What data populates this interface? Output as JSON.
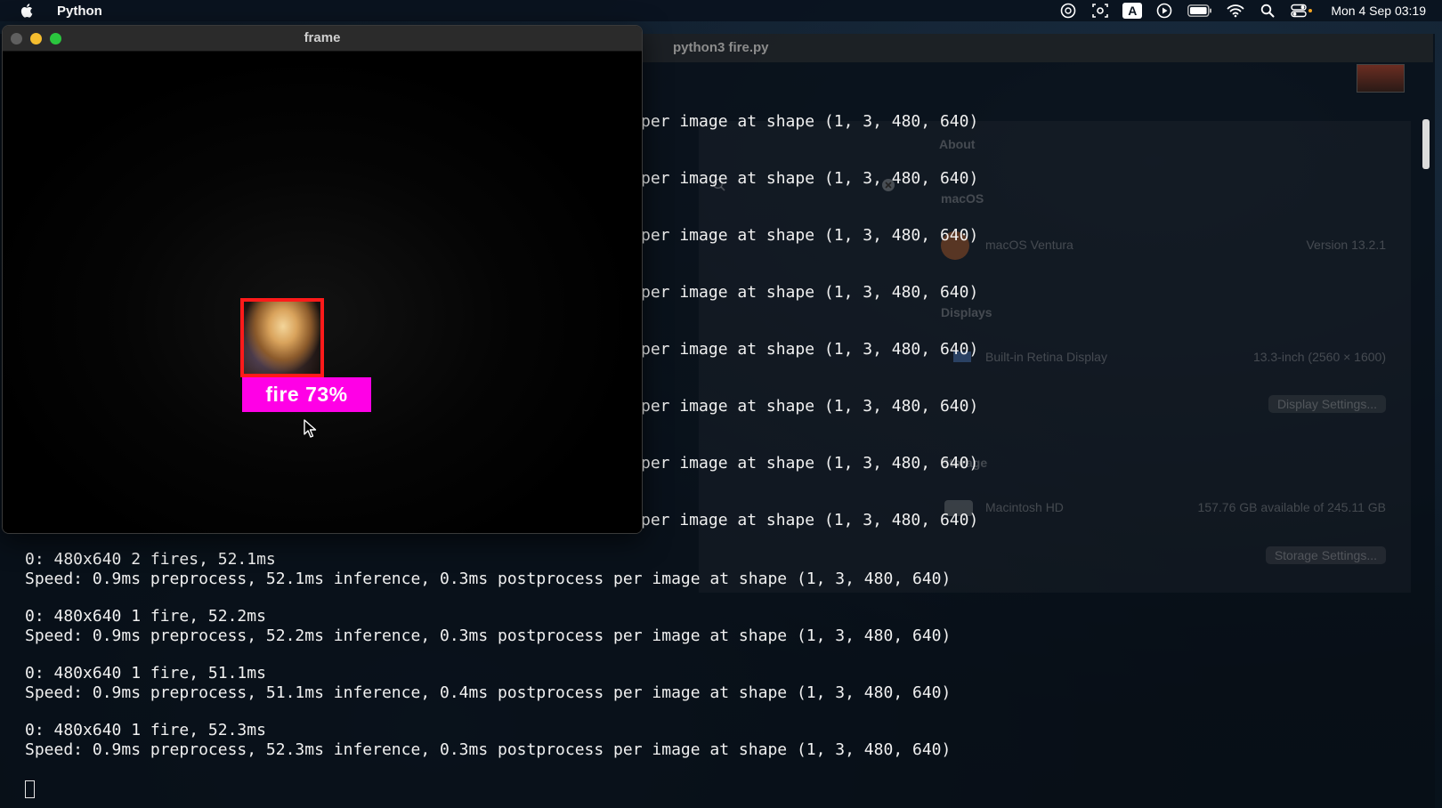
{
  "menubar": {
    "app_name": "Python",
    "clock": "Mon 4 Sep  03:19",
    "icons": [
      "apple-icon",
      "creative-cloud-icon",
      "screenshot-icon",
      "input-source-icon",
      "play-icon",
      "battery-icon",
      "wifi-icon",
      "spotlight-icon",
      "control-center-icon"
    ],
    "input_source": "A"
  },
  "terminal": {
    "title": "python3 fire.py",
    "partial_line": "per image at shape (1, 3, 480, 640)",
    "lines": [
      "0: 480x640 2 fires, 52.1ms",
      "Speed: 0.9ms preprocess, 52.1ms inference, 0.3ms postprocess per image at shape (1, 3, 480, 640)",
      "",
      "0: 480x640 1 fire, 52.2ms",
      "Speed: 0.9ms preprocess, 52.2ms inference, 0.3ms postprocess per image at shape (1, 3, 480, 640)",
      "",
      "0: 480x640 1 fire, 51.1ms",
      "Speed: 0.9ms preprocess, 51.1ms inference, 0.4ms postprocess per image at shape (1, 3, 480, 640)",
      "",
      "0: 480x640 1 fire, 52.3ms",
      "Speed: 0.9ms preprocess, 52.3ms inference, 0.3ms postprocess per image at shape (1, 3, 480, 640)"
    ]
  },
  "frame_window": {
    "title": "frame",
    "detection": {
      "label": "fire 73%",
      "box_color": "#ff1a1a",
      "label_color": "#ff00e6"
    }
  },
  "about_window": {
    "section_title": "About",
    "macos_heading": "macOS",
    "macos_name": "macOS Ventura",
    "macos_version": "Version 13.2.1",
    "displays_heading": "Displays",
    "display_name": "Built-in Retina Display",
    "display_spec": "13.3-inch (2560 × 1600)",
    "display_button": "Display Settings...",
    "storage_heading": "Storage",
    "disk_name": "Macintosh HD",
    "disk_info": "157.76 GB available of 245.11 GB",
    "storage_button": "Storage Settings..."
  }
}
